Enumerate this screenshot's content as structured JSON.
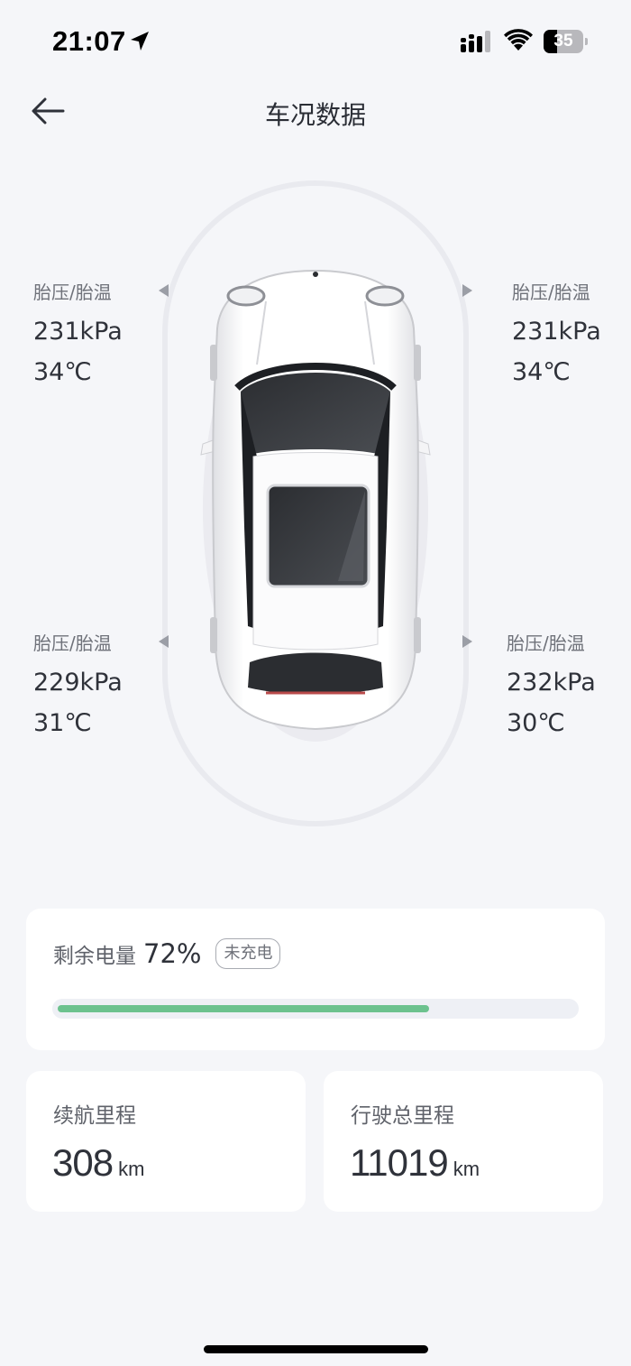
{
  "status_bar": {
    "time": "21:07",
    "battery_level": "35",
    "icons": [
      "location-arrow-icon",
      "cellular-signal-icon",
      "wifi-icon",
      "battery-icon"
    ]
  },
  "nav": {
    "title": "车况数据",
    "back_icon": "back-arrow-icon"
  },
  "tires": {
    "front_left": {
      "label": "胎压/胎温",
      "pressure": "231kPa",
      "temperature": "34℃"
    },
    "front_right": {
      "label": "胎压/胎温",
      "pressure": "231kPa",
      "temperature": "34℃"
    },
    "rear_left": {
      "label": "胎压/胎温",
      "pressure": "229kPa",
      "temperature": "31℃"
    },
    "rear_right": {
      "label": "胎压/胎温",
      "pressure": "232kPa",
      "temperature": "30℃"
    }
  },
  "battery": {
    "label": "剩余电量",
    "percent_text": "72%",
    "percent_value": 72,
    "charge_status": "未充电",
    "bar_color": "#6cc28e"
  },
  "range": {
    "label": "续航里程",
    "value": "308",
    "unit": "km"
  },
  "odometer": {
    "label": "行驶总里程",
    "value": "11019",
    "unit": "km"
  }
}
